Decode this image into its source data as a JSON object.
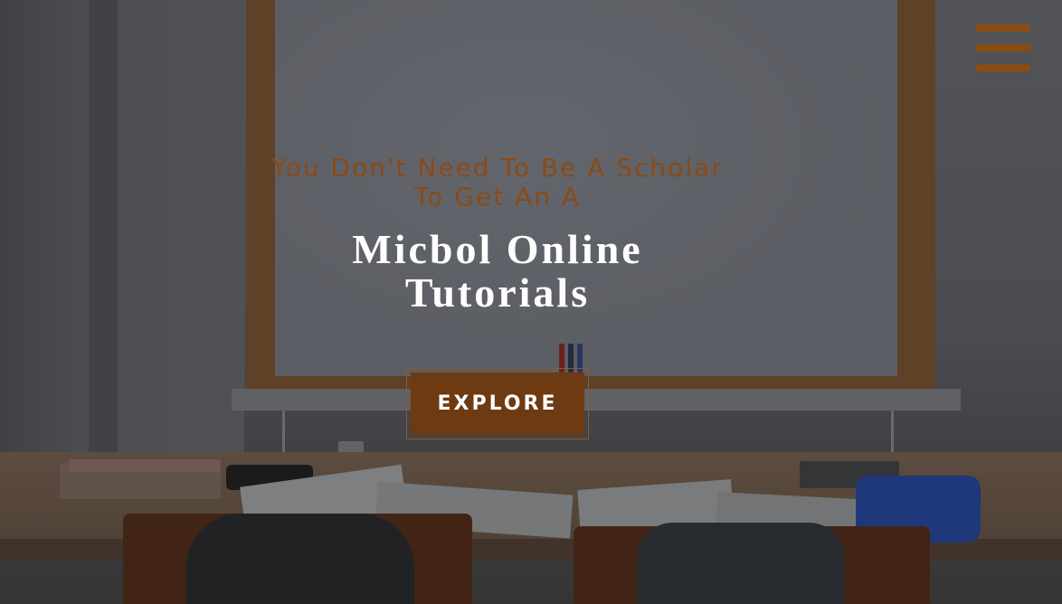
{
  "hero": {
    "tagline": "You Don't Need To Be A Scholar To Get An A",
    "title": "Micbol Online Tutorials",
    "cta_label": "EXPLORE"
  },
  "header": {
    "menu_icon": "hamburger-menu-icon"
  },
  "colors": {
    "accent": "#8b4a16",
    "button_bg": "#6e3a11",
    "title_text": "#ffffff"
  }
}
